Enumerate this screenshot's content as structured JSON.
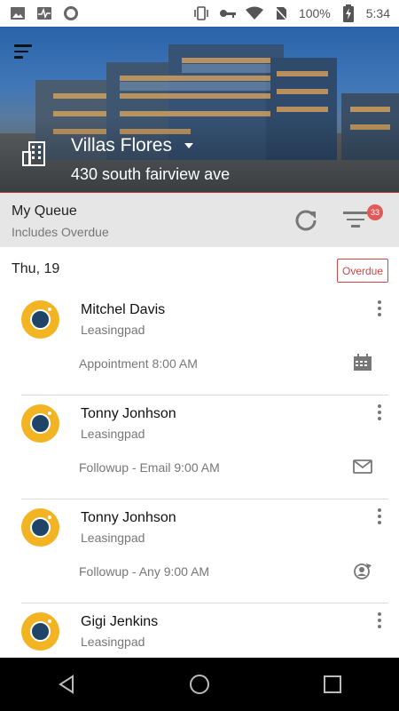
{
  "status_bar": {
    "battery": "100%",
    "time": "5:34"
  },
  "property": {
    "name": "Villas Flores",
    "address": "430 south fairview ave"
  },
  "queue": {
    "title": "My Queue",
    "subtitle": "Includes Overdue",
    "filter_badge": "33"
  },
  "list": {
    "date": "Thu, 19",
    "overdue_label": "Overdue",
    "items": [
      {
        "name": "Mitchel Davis",
        "company": "Leasingpad",
        "activity": "Appointment 8:00 AM",
        "activity_icon": "calendar-icon"
      },
      {
        "name": "Tonny Jonhson",
        "company": "Leasingpad",
        "activity": "Followup - Email 9:00 AM",
        "activity_icon": "envelope-icon"
      },
      {
        "name": "Tonny Jonhson",
        "company": "Leasingpad",
        "activity": "Followup - Any 9:00 AM",
        "activity_icon": "user-followup-icon"
      },
      {
        "name": "Gigi Jenkins",
        "company": "Leasingpad",
        "activity": "",
        "activity_icon": ""
      }
    ]
  },
  "colors": {
    "accent_red": "#d34545",
    "avatar_yellow": "#f3b424",
    "avatar_navy": "#1f4468"
  }
}
